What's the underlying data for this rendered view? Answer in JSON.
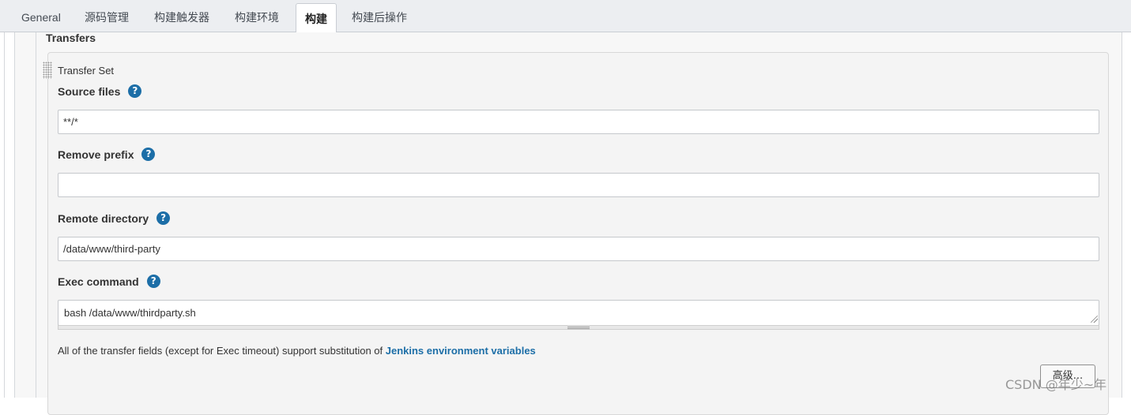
{
  "tabs": [
    {
      "label": "General",
      "active": false
    },
    {
      "label": "源码管理",
      "active": false
    },
    {
      "label": "构建触发器",
      "active": false
    },
    {
      "label": "构建环境",
      "active": false
    },
    {
      "label": "构建",
      "active": true
    },
    {
      "label": "构建后操作",
      "active": false
    }
  ],
  "section": {
    "title": "Transfers"
  },
  "transfer_set": {
    "title": "Transfer Set",
    "fields": {
      "source_files": {
        "label": "Source files",
        "value": "**/*"
      },
      "remove_prefix": {
        "label": "Remove prefix",
        "value": ""
      },
      "remote_directory": {
        "label": "Remote directory",
        "value": "/data/www/third-party"
      },
      "exec_command": {
        "label": "Exec command",
        "value": "bash /data/www/thirdparty.sh"
      }
    },
    "help_icon": {
      "glyph": "?",
      "icon": "help-icon",
      "color": "#1c6ea7"
    }
  },
  "note": {
    "text": "All of the transfer fields (except for Exec timeout) support substitution of ",
    "link": "Jenkins environment variables"
  },
  "advanced_button": {
    "label": "高级..."
  },
  "watermark": "CSDN @年少~年"
}
